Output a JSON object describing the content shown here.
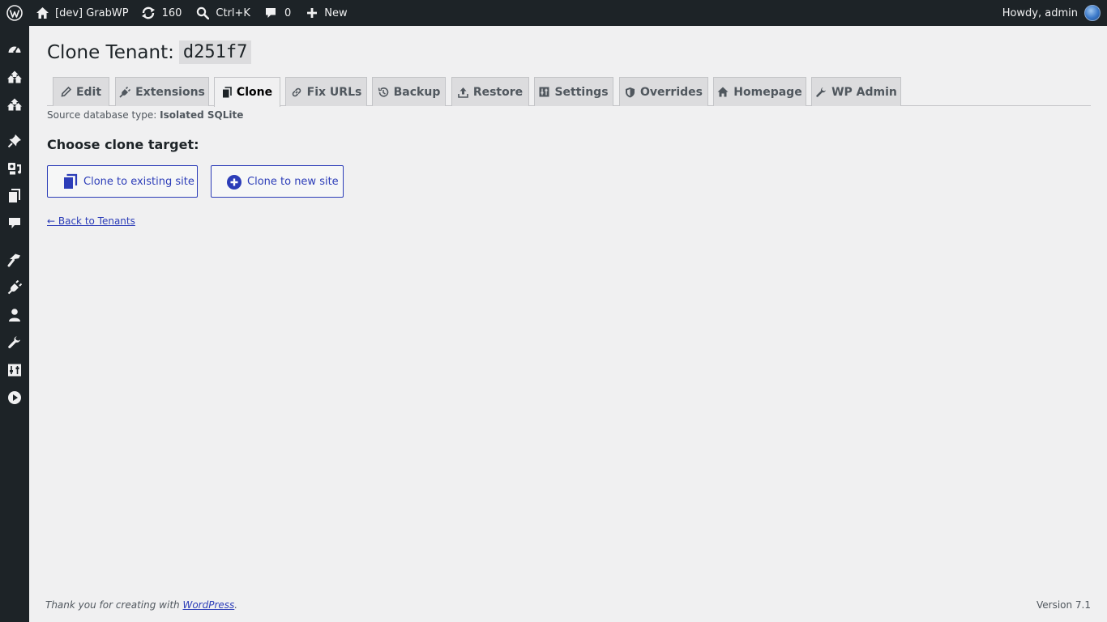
{
  "adminbar": {
    "site_name": "[dev] GrabWP",
    "updates_count": "160",
    "search_label": "Ctrl+K",
    "comments_count": "0",
    "new_label": "New",
    "howdy": "Howdy, admin"
  },
  "sidemenu": {
    "icons": [
      "dashboard-icon",
      "network-icon",
      "network-icon",
      "pin-icon",
      "media-icon",
      "pages-icon",
      "comments-icon",
      "appearance-icon",
      "plugins-icon",
      "users-icon",
      "tools-icon",
      "settings-icon",
      "play-icon"
    ]
  },
  "page": {
    "title": "Clone Tenant:",
    "tenant_id": "d251f7",
    "tabs": [
      {
        "label": "Edit",
        "icon": "pencil-icon"
      },
      {
        "label": "Extensions",
        "icon": "plug-icon"
      },
      {
        "label": "Clone",
        "icon": "clone-icon",
        "active": true
      },
      {
        "label": "Fix URLs",
        "icon": "link-icon"
      },
      {
        "label": "Backup",
        "icon": "history-icon"
      },
      {
        "label": "Restore",
        "icon": "upload-icon"
      },
      {
        "label": "Settings",
        "icon": "settings-icon"
      },
      {
        "label": "Overrides",
        "icon": "shield-icon"
      },
      {
        "label": "Homepage",
        "icon": "home-icon"
      },
      {
        "label": "WP Admin",
        "icon": "wrench-icon"
      }
    ],
    "source_label": "Source database type:",
    "source_value": "Isolated SQLite",
    "choose_heading": "Choose clone target:",
    "btn_existing": "Clone to existing site",
    "btn_new": "Clone to new site",
    "back_link": "← Back to Tenants"
  },
  "footer": {
    "thanks_prefix": "Thank you for creating with",
    "wordpress_link": "WordPress",
    "thanks_suffix": ".",
    "version": "Version 7.1"
  },
  "colors": {
    "adminbar_bg": "#1d2327",
    "page_bg": "#f0f0f1",
    "accent": "#2c3db8"
  }
}
